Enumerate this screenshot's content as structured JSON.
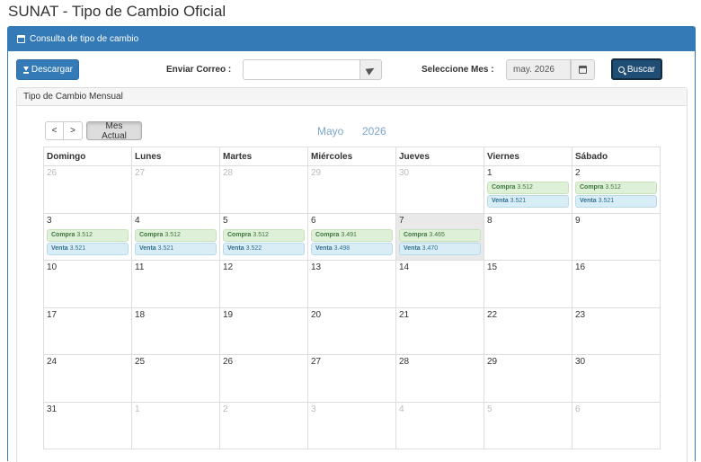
{
  "page_title": "SUNAT - Tipo de Cambio Oficial",
  "panel": {
    "heading": "Consulta de tipo de cambio"
  },
  "toolbar": {
    "download_label": "Descargar",
    "email_label": "Enviar Correo :",
    "email_value": "",
    "email_placeholder": "",
    "month_label": "Seleccione Mes :",
    "month_value": "may. 2026",
    "search_label": "Buscar"
  },
  "inner_panel": {
    "heading": "Tipo de Cambio Mensual"
  },
  "calendar": {
    "prev_label": "<",
    "next_label": ">",
    "current_month_label": "Mes Actual",
    "month_name": "Mayo",
    "year": "2026",
    "weekdays": [
      "Domingo",
      "Lunes",
      "Martes",
      "Miércoles",
      "Jueves",
      "Viernes",
      "Sábado"
    ],
    "compra_label": "Compra",
    "venta_label": "Venta",
    "weeks": [
      [
        {
          "day": "26",
          "other": true
        },
        {
          "day": "27",
          "other": true
        },
        {
          "day": "28",
          "other": true
        },
        {
          "day": "29",
          "other": true
        },
        {
          "day": "30",
          "other": true
        },
        {
          "day": "1",
          "compra": "3.512",
          "venta": "3.521"
        },
        {
          "day": "2",
          "compra": "3.512",
          "venta": "3.521"
        }
      ],
      [
        {
          "day": "3",
          "compra": "3.512",
          "venta": "3.521"
        },
        {
          "day": "4",
          "compra": "3.512",
          "venta": "3.521"
        },
        {
          "day": "5",
          "compra": "3.512",
          "venta": "3.522"
        },
        {
          "day": "6",
          "compra": "3.491",
          "venta": "3.498"
        },
        {
          "day": "7",
          "compra": "3.465",
          "venta": "3.470",
          "today": true
        },
        {
          "day": "8"
        },
        {
          "day": "9"
        }
      ],
      [
        {
          "day": "10"
        },
        {
          "day": "11"
        },
        {
          "day": "12"
        },
        {
          "day": "13"
        },
        {
          "day": "14"
        },
        {
          "day": "15"
        },
        {
          "day": "16"
        }
      ],
      [
        {
          "day": "17"
        },
        {
          "day": "18"
        },
        {
          "day": "19"
        },
        {
          "day": "20"
        },
        {
          "day": "21"
        },
        {
          "day": "22"
        },
        {
          "day": "23"
        }
      ],
      [
        {
          "day": "24"
        },
        {
          "day": "25"
        },
        {
          "day": "26"
        },
        {
          "day": "27"
        },
        {
          "day": "28"
        },
        {
          "day": "29"
        },
        {
          "day": "30"
        }
      ],
      [
        {
          "day": "31"
        },
        {
          "day": "1",
          "other": true
        },
        {
          "day": "2",
          "other": true
        },
        {
          "day": "3",
          "other": true
        },
        {
          "day": "4",
          "other": true
        },
        {
          "day": "5",
          "other": true
        },
        {
          "day": "6",
          "other": true
        }
      ]
    ]
  }
}
